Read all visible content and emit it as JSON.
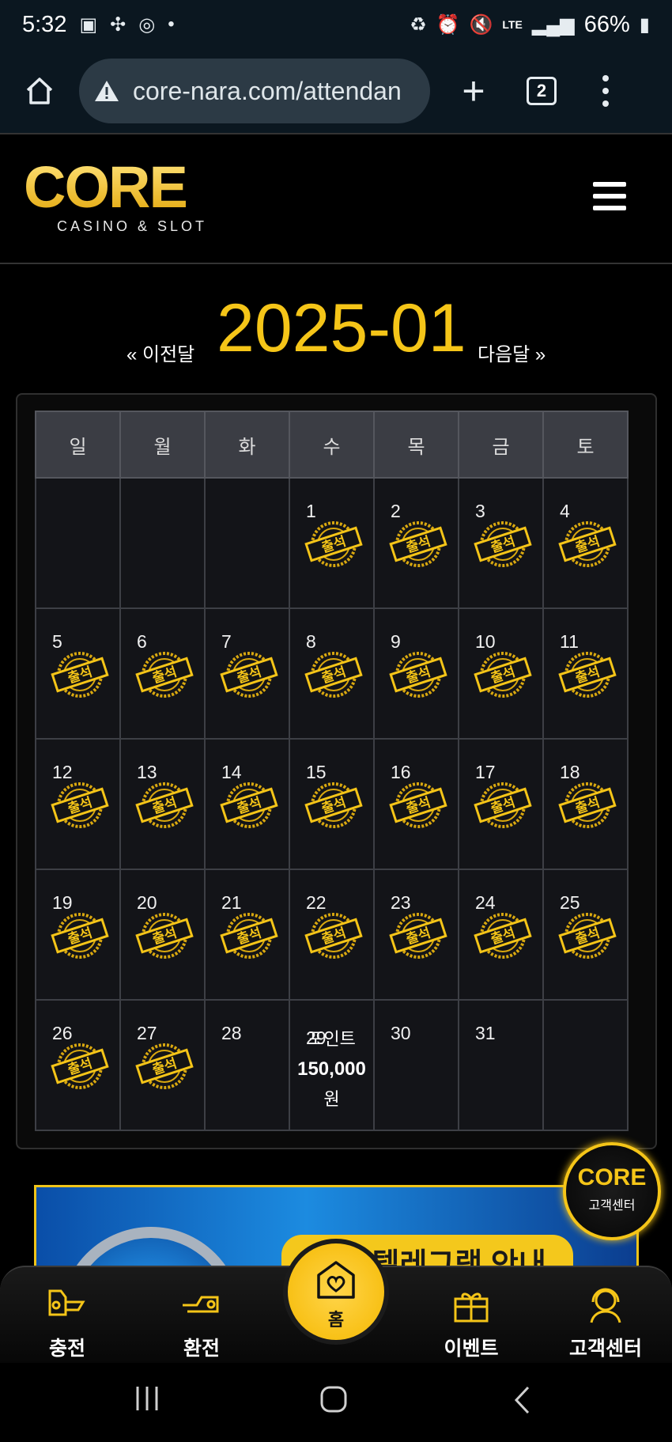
{
  "status_bar": {
    "time": "5:32",
    "battery": "66%",
    "network": "LTE"
  },
  "browser": {
    "url": "core-nara.com/attendan",
    "tab_count": "2"
  },
  "site": {
    "logo_text": "CORE",
    "logo_subtitle": "CASINO & SLOT"
  },
  "month_nav": {
    "prev_label": "« 이전달",
    "current_month": "2025-01",
    "next_label": "다음달 »"
  },
  "calendar": {
    "weekdays": [
      "일",
      "월",
      "화",
      "수",
      "목",
      "금",
      "토"
    ],
    "stamp_label": "출석",
    "weeks": [
      [
        "",
        "",
        "",
        "1",
        "2",
        "3",
        "4"
      ],
      [
        "5",
        "6",
        "7",
        "8",
        "9",
        "10",
        "11"
      ],
      [
        "12",
        "13",
        "14",
        "15",
        "16",
        "17",
        "18"
      ],
      [
        "19",
        "20",
        "21",
        "22",
        "23",
        "24",
        "25"
      ],
      [
        "26",
        "27",
        "28",
        "29",
        "30",
        "31",
        ""
      ]
    ],
    "attended_days": [
      1,
      2,
      3,
      4,
      5,
      6,
      7,
      8,
      9,
      10,
      11,
      12,
      13,
      14,
      15,
      16,
      17,
      18,
      19,
      20,
      21,
      22,
      23,
      24,
      25,
      26,
      27
    ],
    "point_reward": {
      "day": "29",
      "prefix": "포인트",
      "amount": "150,000",
      "unit": "원"
    }
  },
  "banner": {
    "text": "공식 텔레그램 안내"
  },
  "support_badge": {
    "logo": "CORE",
    "label": "고객센터"
  },
  "bottom_nav": {
    "items": [
      {
        "label": "충전",
        "icon": "deposit-icon"
      },
      {
        "label": "환전",
        "icon": "withdraw-icon"
      },
      {
        "label": "홈",
        "icon": "home-heart-icon"
      },
      {
        "label": "이벤트",
        "icon": "gift-icon"
      },
      {
        "label": "고객센터",
        "icon": "support-agent-icon"
      }
    ]
  },
  "colors": {
    "accent": "#f5c518",
    "sunday": "#e8212c",
    "saturday": "#3ea0ee",
    "header_bg": "#3b3d44"
  }
}
